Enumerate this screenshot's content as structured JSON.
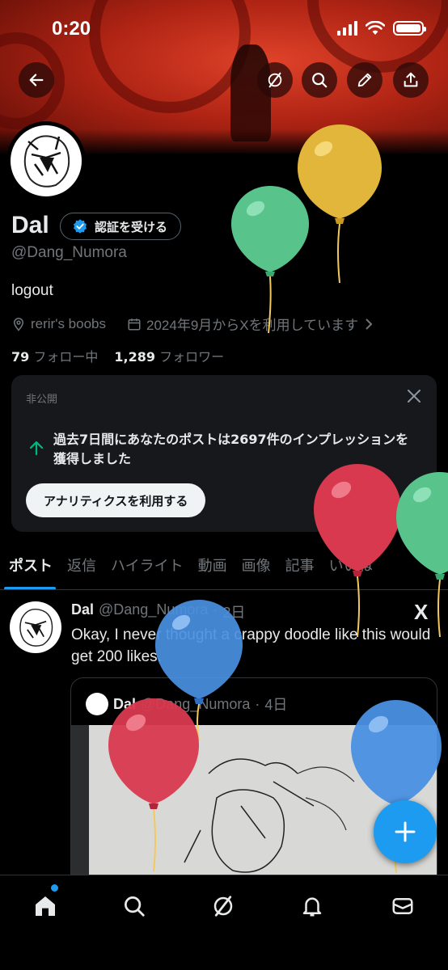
{
  "status_bar": {
    "time": "0:20"
  },
  "profile": {
    "name": "Dal",
    "verify_label": "認証を受ける",
    "handle": "@Dang_Numora",
    "bio": "logout",
    "location": "rerir's boobs",
    "joined": "2024年9月からXを利用しています",
    "following_count": "79",
    "following_label": "フォロー中",
    "followers_count": "1,289",
    "followers_label": "フォロワー"
  },
  "private_card": {
    "label": "非公開",
    "message": "過去7日間にあなたのポストは2697件のインプレッションを獲得しました",
    "cta": "アナリティクスを利用する"
  },
  "tabs": [
    "ポスト",
    "返信",
    "ハイライト",
    "動画",
    "画像",
    "記事",
    "いいね"
  ],
  "post": {
    "name": "Dal",
    "handle": "@Dang_Numora",
    "time": "2日",
    "logo": "X",
    "text": "Okay, I never thought a crappy doodle like this would get 200 likes.",
    "quote": {
      "name": "Dal",
      "handle": "@Dang_Numora",
      "time": "4日"
    }
  },
  "icons": {
    "top": [
      "back-arrow-icon",
      "grok-icon",
      "search-icon",
      "edit-icon",
      "share-icon"
    ],
    "bottom_nav": [
      "home-icon",
      "search-icon",
      "grok-icon",
      "bell-icon",
      "mail-icon"
    ]
  },
  "colors": {
    "accent": "#1d9bf0",
    "background": "#000000",
    "card": "#16181c"
  }
}
